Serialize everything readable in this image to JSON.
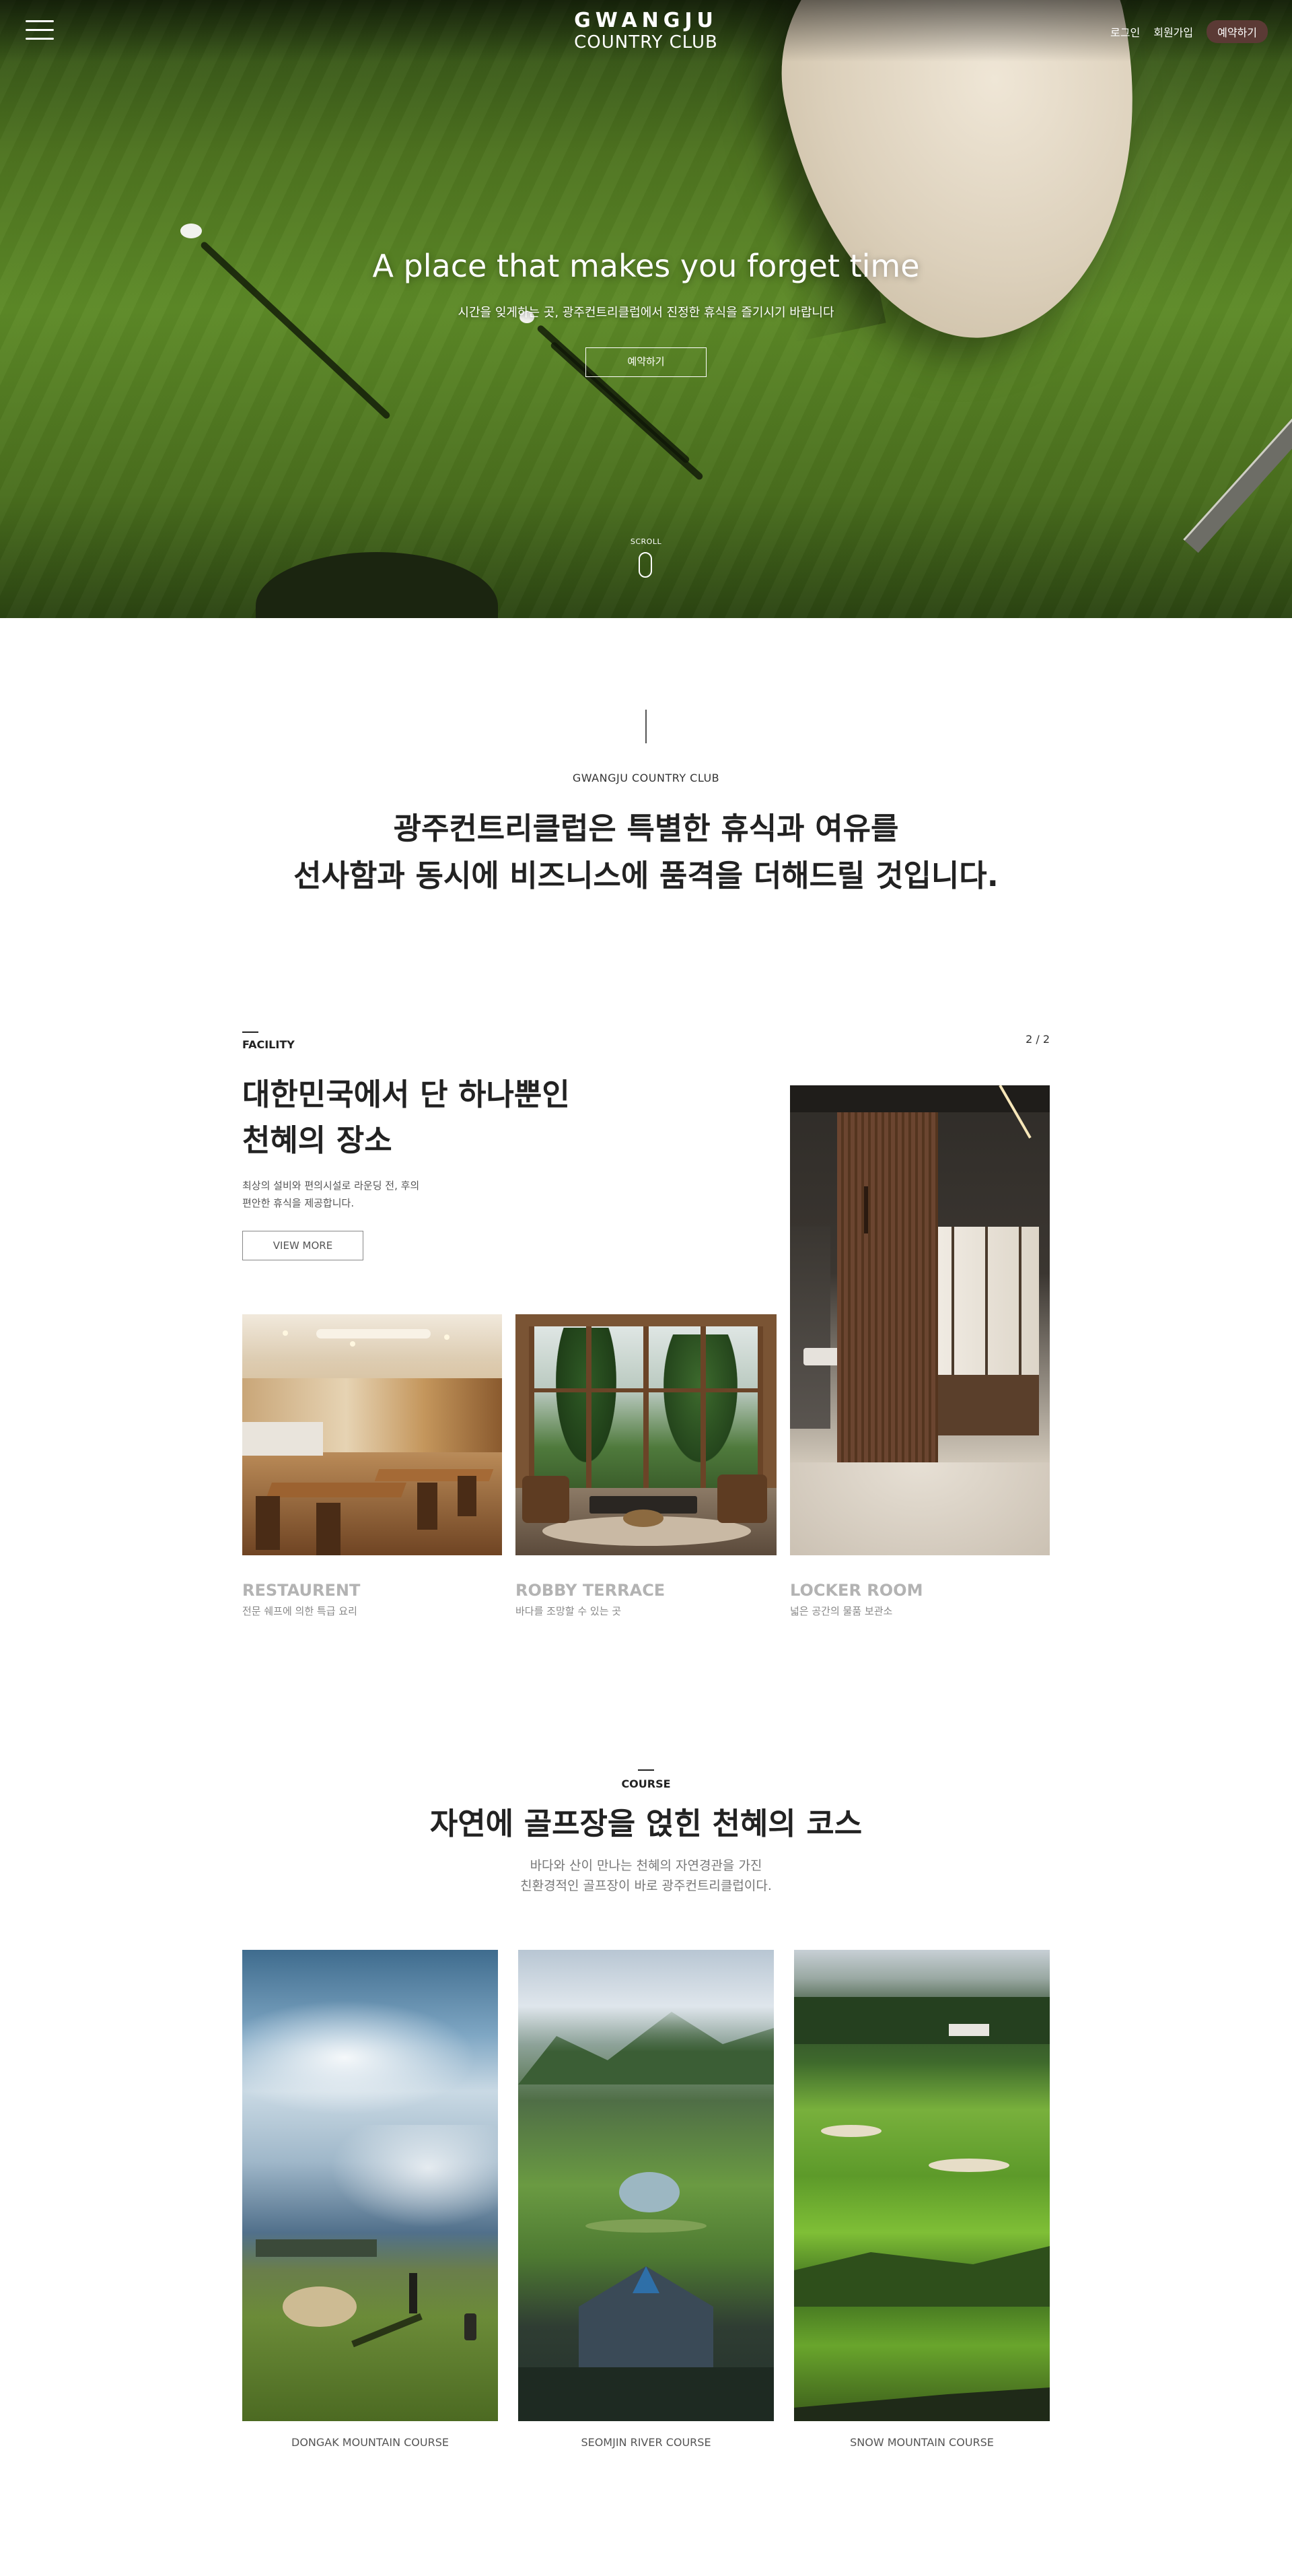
{
  "header": {
    "logo_line1": "GWANGJU",
    "logo_line2": "COUNTRY CLUB",
    "login": "로그인",
    "signup": "회원가입",
    "reserve": "예약하기"
  },
  "hero": {
    "title": "A place that makes you forget time",
    "subtitle": "시간을 잊게하는 곳, 광주컨트리클럽에서 진정한 휴식을 즐기시기 바랍니다",
    "button": "예약하기",
    "scroll": "SCROLL"
  },
  "intro": {
    "tag": "GWANGJU COUNTRY CLUB",
    "line1": "광주컨트리클럽은 특별한 휴식과 여유를",
    "line2": "선사함과 동시에 비즈니스에 품격을 더해드릴 것입니다."
  },
  "facility": {
    "label": "FACILITY",
    "pager": "2 / 2",
    "title_line1": "대한민국에서 단 하나뿐인",
    "title_line2": "천혜의 장소",
    "desc_line1": "최상의 설비와 편의시설로 라운딩 전, 후의",
    "desc_line2": "편안한 휴식을 제공합니다.",
    "more": "VIEW MORE",
    "items": [
      {
        "name": "RESTAURENT",
        "sub": "전문 쉐프에 의한 특급 요리"
      },
      {
        "name": "ROBBY TERRACE",
        "sub": "바다를 조망할 수 있는 곳"
      },
      {
        "name": "LOCKER ROOM",
        "sub": "넓은 공간의 물품 보관소"
      }
    ]
  },
  "course": {
    "label": "COURSE",
    "title": "자연에 골프장을 얹힌 천혜의 코스",
    "desc_line1": "바다와 산이 만나는 천혜의 자연경관을 가진",
    "desc_line2": "친환경적인 골프장이 바로 광주컨트리클럽이다.",
    "items": [
      {
        "name": "DONGAK MOUNTAIN COURSE"
      },
      {
        "name": "SEOMJIN RIVER COURSE"
      },
      {
        "name": "SNOW MOUNTAIN COURSE"
      }
    ]
  },
  "colors": {
    "accent_pill": "#5b3a35",
    "text_dark": "#222222",
    "text_muted": "#b3b3b3"
  },
  "icons": [
    "hamburger-menu-icon",
    "scroll-mouse-icon"
  ]
}
